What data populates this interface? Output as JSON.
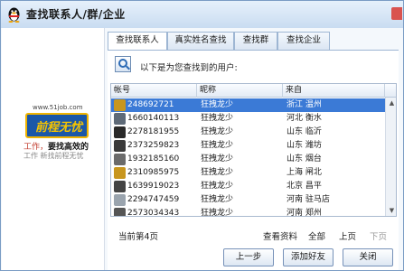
{
  "window": {
    "title": "查找联系人/群/企业"
  },
  "ad": {
    "url": "www.51job.com",
    "logo": "前程无忧",
    "slogan_prefix": "工作，",
    "slogan_bold": "要找高效的",
    "slogan_line2": "工作 新找前程无忧"
  },
  "tabs": [
    {
      "label": "查找联系人",
      "active": true
    },
    {
      "label": "真实姓名查找",
      "active": false
    },
    {
      "label": "查找群",
      "active": false
    },
    {
      "label": "查找企业",
      "active": false
    }
  ],
  "results": {
    "title": "以下是为您查找到的用户:",
    "columns": [
      "帐号",
      "昵称",
      "来自"
    ],
    "rows": [
      {
        "account": "248692721",
        "nickname": "狂拽龙少",
        "from": "浙江 温州",
        "avatar_color": "#c8961e"
      },
      {
        "account": "1660140113",
        "nickname": "狂拽龙少",
        "from": "河北 衡水",
        "avatar_color": "#5e6a78"
      },
      {
        "account": "2278181955",
        "nickname": "狂拽龙少",
        "from": "山东 临沂",
        "avatar_color": "#2a2a2a"
      },
      {
        "account": "2373259823",
        "nickname": "狂拽龙少",
        "from": "山东 潍坊",
        "avatar_color": "#3a3a3a"
      },
      {
        "account": "1932185160",
        "nickname": "狂拽龙少",
        "from": "山东 烟台",
        "avatar_color": "#6b6b6b"
      },
      {
        "account": "2310985975",
        "nickname": "狂拽龙少",
        "from": "上海 闸北",
        "avatar_color": "#c8961e"
      },
      {
        "account": "1639919023",
        "nickname": "狂拽龙少",
        "from": "北京 昌平",
        "avatar_color": "#444444"
      },
      {
        "account": "2294747459",
        "nickname": "狂拽龙少",
        "from": "河南 驻马店",
        "avatar_color": "#9aa4ae"
      },
      {
        "account": "2573034343",
        "nickname": "狂拽龙少",
        "from": "河南 郑州",
        "avatar_color": "#555555"
      }
    ]
  },
  "footer": {
    "page_info": "当前第4页",
    "view_profile": "查看资料",
    "all": "全部",
    "prev_page": "上页",
    "next_page": "下页"
  },
  "buttons": {
    "back": "上一步",
    "add_friend": "添加好友",
    "close": "关闭"
  }
}
